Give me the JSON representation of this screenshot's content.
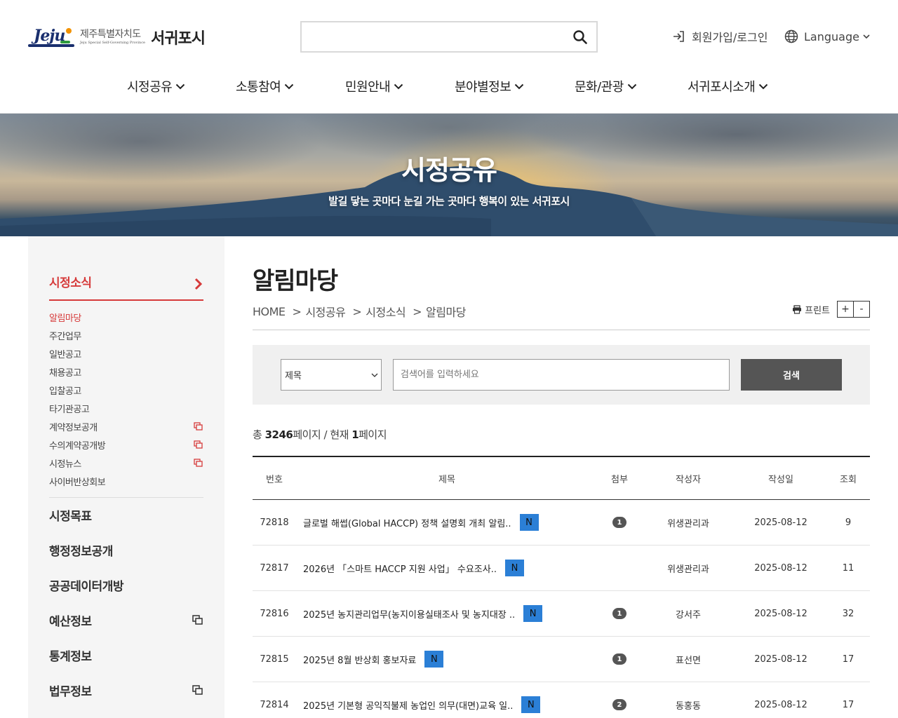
{
  "header": {
    "logo_brand": "Jeju",
    "logo_province": "제주특별자치도",
    "logo_province_en": "Jeju Special Self-Governing Province",
    "logo_city": "서귀포시",
    "search_placeholder": "",
    "login_label": "회원가입/로그인",
    "language_label": "Language",
    "icons": {
      "search": "search-icon",
      "login": "login-icon",
      "language": "globe-icon"
    }
  },
  "gnb": [
    {
      "label": "시정공유"
    },
    {
      "label": "소통참여"
    },
    {
      "label": "민원안내"
    },
    {
      "label": "분야별정보"
    },
    {
      "label": "문화/관광"
    },
    {
      "label": "서귀포시소개"
    }
  ],
  "banner": {
    "title": "시정공유",
    "subtitle": "발길 닿는 곳마다 눈길 가는 곳마다 행복이 있는 서귀포시"
  },
  "sidebar": {
    "section_title": "시정소식",
    "sub_items": [
      {
        "label": "알림마당",
        "active": true,
        "external": false
      },
      {
        "label": "주간업무",
        "active": false,
        "external": false
      },
      {
        "label": "일반공고",
        "active": false,
        "external": false
      },
      {
        "label": "채용공고",
        "active": false,
        "external": false
      },
      {
        "label": "입찰공고",
        "active": false,
        "external": false
      },
      {
        "label": "타기관공고",
        "active": false,
        "external": false
      },
      {
        "label": "계약정보공개",
        "active": false,
        "external": true
      },
      {
        "label": "수의계약공개방",
        "active": false,
        "external": true
      },
      {
        "label": "시정뉴스",
        "active": false,
        "external": true
      },
      {
        "label": "사이버반상회보",
        "active": false,
        "external": false
      }
    ],
    "main_items": [
      {
        "label": "시정목표",
        "external": false
      },
      {
        "label": "행정정보공개",
        "external": false
      },
      {
        "label": "공공데이터개방",
        "external": false
      },
      {
        "label": "예산정보",
        "external": true
      },
      {
        "label": "통계정보",
        "external": false
      },
      {
        "label": "법무정보",
        "external": true
      }
    ]
  },
  "content": {
    "page_title": "알림마당",
    "breadcrumb": [
      "HOME",
      "시정공유",
      "시정소식",
      "알림마당"
    ],
    "breadcrumb_sep": ">",
    "print_label": "프린트",
    "zoom_in": "+",
    "zoom_out": "-",
    "search": {
      "select_value": "제목",
      "keyword_placeholder": "검색어를 입력하세요",
      "submit_label": "검색"
    },
    "count": {
      "prefix": "총 ",
      "total": "3246",
      "mid": "페이지 / 현재 ",
      "current": "1",
      "suffix": "페이지"
    },
    "table": {
      "headers": [
        "번호",
        "제목",
        "첨부",
        "작성자",
        "작성일",
        "조회"
      ],
      "new_badge": "N",
      "rows": [
        {
          "num": "72818",
          "title": "글로벌 해썹(Global HACCP) 정책 설명회 개최 알림..",
          "attach": "1",
          "author": "위생관리과",
          "date": "2025-08-12",
          "views": "9"
        },
        {
          "num": "72817",
          "title": "2026년 「스마트 HACCP 지원 사업」 수요조사..",
          "attach": "",
          "author": "위생관리과",
          "date": "2025-08-12",
          "views": "11"
        },
        {
          "num": "72816",
          "title": "2025년 농지관리업무(농지이용실태조사 및 농지대장 ..",
          "attach": "1",
          "author": "강서주",
          "date": "2025-08-12",
          "views": "32"
        },
        {
          "num": "72815",
          "title": "2025년 8월 반상회 홍보자료",
          "attach": "1",
          "author": "표선면",
          "date": "2025-08-12",
          "views": "17"
        },
        {
          "num": "72814",
          "title": "2025년 기본형 공익직불제 농업인 의무(대면)교육 일..",
          "attach": "2",
          "author": "동홍동",
          "date": "2025-08-12",
          "views": "17"
        }
      ]
    }
  },
  "colors": {
    "accent": "#d63a3a",
    "new_badge": "#2b7fd6",
    "search_button": "#555555"
  }
}
